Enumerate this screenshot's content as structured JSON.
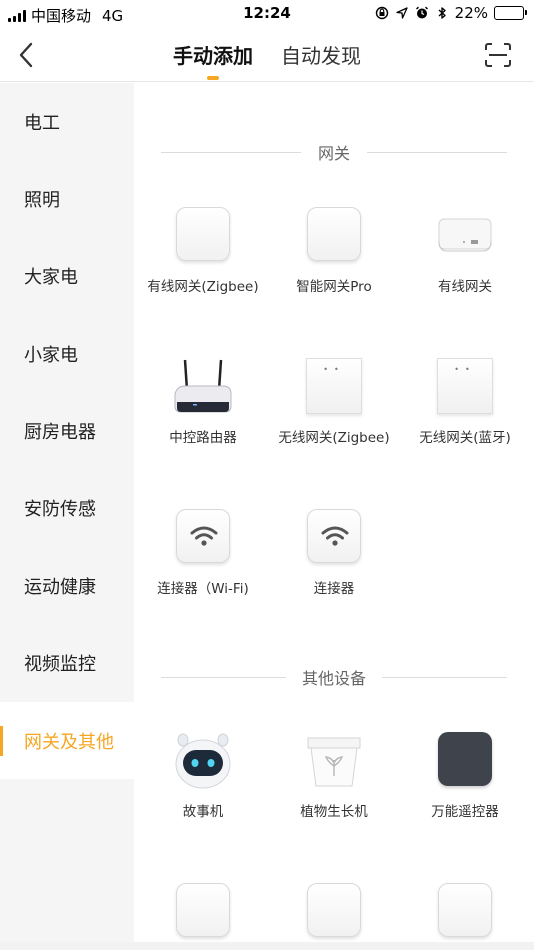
{
  "status_bar": {
    "carrier": "中国移动",
    "network": "4G",
    "time": "12:24",
    "battery": "22%",
    "battery_level": 0.22
  },
  "nav": {
    "tabs": [
      {
        "label": "手动添加",
        "active": true
      },
      {
        "label": "自动发现",
        "active": false
      }
    ],
    "accent_color": "#f5a623"
  },
  "sidebar": {
    "items": [
      {
        "label": "电工"
      },
      {
        "label": "照明"
      },
      {
        "label": "大家电"
      },
      {
        "label": "小家电"
      },
      {
        "label": "厨房电器"
      },
      {
        "label": "安防传感"
      },
      {
        "label": "运动健康"
      },
      {
        "label": "视频监控"
      },
      {
        "label": "网关及其他",
        "active": true
      }
    ]
  },
  "sections": [
    {
      "title": "网关",
      "devices": [
        {
          "label": "有线网关(Zigbee)",
          "icon": "white-square-gateway-icon"
        },
        {
          "label": "智能网关Pro",
          "icon": "white-square-gateway-icon"
        },
        {
          "label": "有线网关",
          "icon": "flat-gateway-hub-icon"
        },
        {
          "label": "中控路由器",
          "icon": "router-antennas-icon"
        },
        {
          "label": "无线网关(Zigbee)",
          "icon": "white-cube-gateway-icon"
        },
        {
          "label": "无线网关(蓝牙)",
          "icon": "white-cube-gateway-icon"
        },
        {
          "label": "连接器（Wi-Fi)",
          "icon": "wifi-connector-icon"
        },
        {
          "label": "连接器",
          "icon": "wifi-connector-icon"
        }
      ]
    },
    {
      "title": "其他设备",
      "devices": [
        {
          "label": "故事机",
          "icon": "robot-story-machine-icon"
        },
        {
          "label": "植物生长机",
          "icon": "plant-pot-icon"
        },
        {
          "label": "万能遥控器",
          "icon": "dark-square-remote-icon"
        }
      ]
    }
  ]
}
